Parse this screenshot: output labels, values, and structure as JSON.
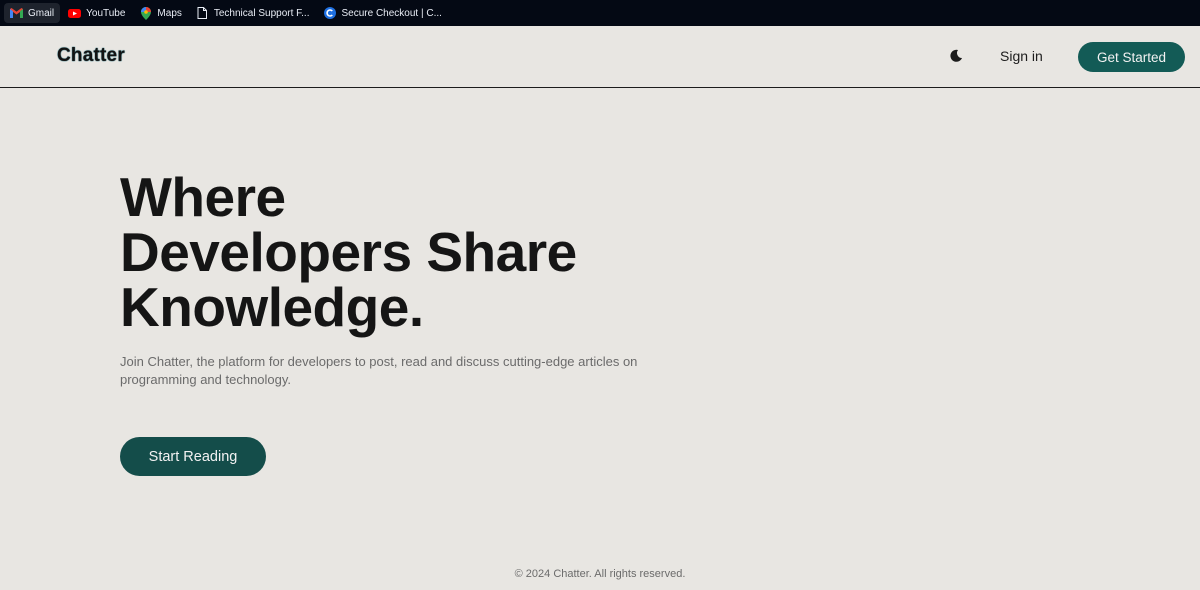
{
  "bookmarks": [
    {
      "label": "Gmail",
      "icon": "gmail-icon"
    },
    {
      "label": "YouTube",
      "icon": "youtube-icon"
    },
    {
      "label": "Maps",
      "icon": "maps-icon"
    },
    {
      "label": "Technical Support F...",
      "icon": "document-icon"
    },
    {
      "label": "Secure Checkout | C...",
      "icon": "c-logo-icon"
    }
  ],
  "header": {
    "logo": "Chatter",
    "theme_icon": "moon-icon",
    "signin_label": "Sign in",
    "get_started_label": "Get Started"
  },
  "hero": {
    "title_lines": [
      "Where",
      "Developers Share",
      "Knowledge."
    ],
    "subtitle": "Join Chatter, the platform for developers to post, read and discuss cutting-edge articles on programming and technology.",
    "cta_label": "Start Reading"
  },
  "footer": {
    "text": "© 2024 Chatter. All rights reserved."
  },
  "colors": {
    "background": "#e8e6e2",
    "accent": "#135b56",
    "bookmarks_bar": "#040914"
  }
}
